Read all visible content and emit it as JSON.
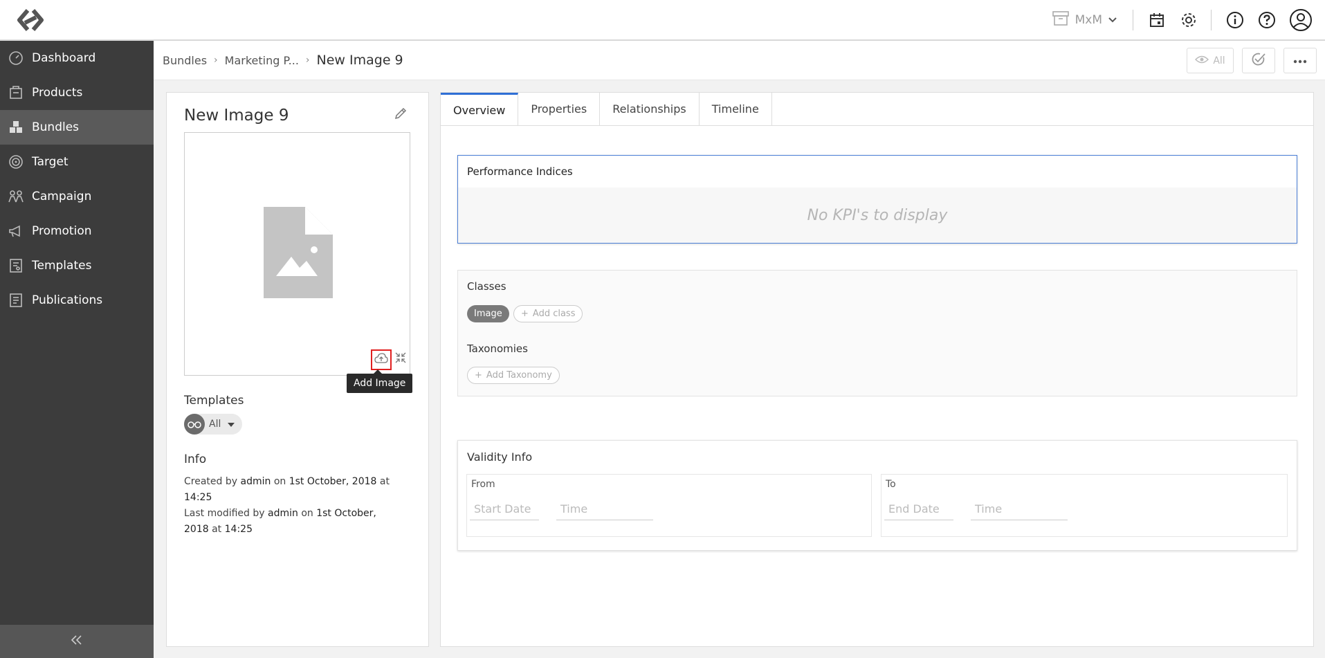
{
  "topbar": {
    "workspace": "MxM"
  },
  "sidebar": {
    "items": [
      {
        "label": "Dashboard",
        "icon": "dashboard-icon"
      },
      {
        "label": "Products",
        "icon": "products-icon"
      },
      {
        "label": "Bundles",
        "icon": "bundles-icon",
        "active": true
      },
      {
        "label": "Target",
        "icon": "target-icon"
      },
      {
        "label": "Campaign",
        "icon": "campaign-icon"
      },
      {
        "label": "Promotion",
        "icon": "promotion-icon"
      },
      {
        "label": "Templates",
        "icon": "templates-icon"
      },
      {
        "label": "Publications",
        "icon": "publications-icon"
      }
    ]
  },
  "breadcrumb": {
    "items": [
      "Bundles",
      "Marketing P..."
    ],
    "current": "New Image 9"
  },
  "actions": {
    "view_label": "All"
  },
  "asset": {
    "title": "New Image 9",
    "tooltip": "Add Image",
    "templates_label": "Templates",
    "templates_value": "All",
    "info_label": "Info",
    "created_prefix": "Created by",
    "created_by": "admin",
    "created_on_word": "on",
    "created_date": "1st October, 2018",
    "created_at_word": "at",
    "created_time": "14:25",
    "modified_prefix": "Last modified by",
    "modified_by": "admin",
    "modified_on_word": "on",
    "modified_date_1": "1st October,",
    "modified_date_2": "2018",
    "modified_at_word": "at",
    "modified_time": "14:25"
  },
  "tabs": [
    "Overview",
    "Properties",
    "Relationships",
    "Timeline"
  ],
  "kpi": {
    "title": "Performance Indices",
    "empty": "No KPI's to display"
  },
  "classes": {
    "title": "Classes",
    "chip": "Image",
    "add_class": "Add class",
    "taxonomies_title": "Taxonomies",
    "add_taxonomy": "Add Taxonomy"
  },
  "validity": {
    "title": "Validity Info",
    "from_label": "From",
    "start_date_placeholder": "Start Date",
    "from_time_placeholder": "Time",
    "to_label": "To",
    "end_date_placeholder": "End Date",
    "to_time_placeholder": "Time"
  },
  "colors": {
    "sidebar_bg": "#3c3c3c",
    "sidebar_active": "#5a5a5a",
    "accent": "#2f6fd6",
    "highlight": "#e02020"
  }
}
